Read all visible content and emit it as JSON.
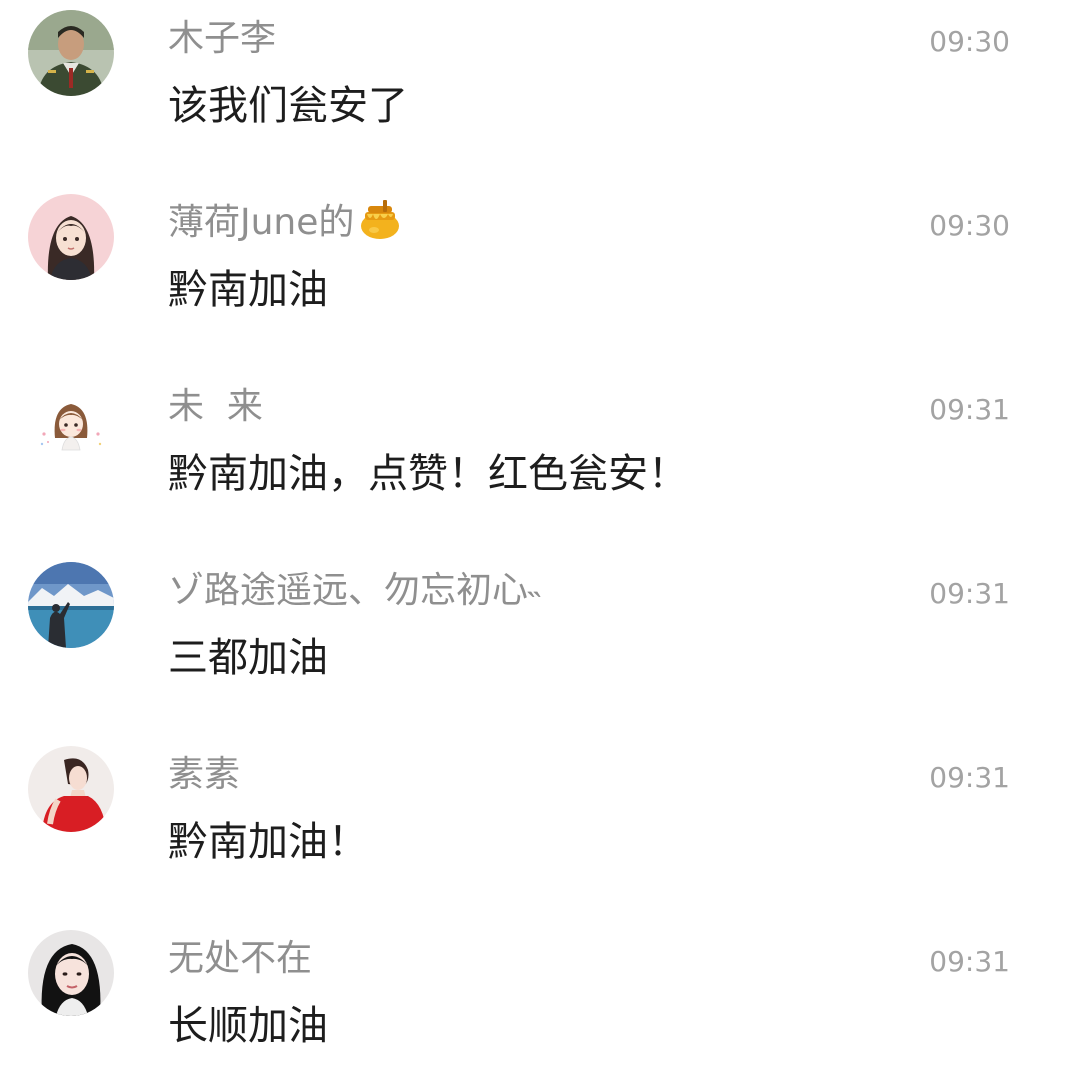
{
  "comments": [
    {
      "name": "木子李",
      "time": "09:30",
      "text": "该我们瓮安了",
      "avatar_icon": "soldier-portrait-icon"
    },
    {
      "name": "薄荷June的",
      "name_emoji": "honey-pot-icon",
      "time": "09:30",
      "text": "黔南加油",
      "avatar_icon": "cartoon-girl-icon"
    },
    {
      "name": "未  来",
      "time": "09:31",
      "text": "黔南加油，点赞！红色瓮安！",
      "avatar_icon": "chibi-girl-icon"
    },
    {
      "name": "ゾ路途遥远、勿忘初心˵",
      "time": "09:31",
      "text": "三都加油",
      "avatar_icon": "lake-landscape-icon"
    },
    {
      "name": "素素",
      "time": "09:31",
      "text": "黔南加油！",
      "avatar_icon": "woman-red-dress-icon"
    },
    {
      "name": "无处不在",
      "time": "09:31",
      "text": "长顺加油",
      "avatar_icon": "woman-portrait-icon"
    }
  ],
  "colors": {
    "name": "#8f8f8f",
    "time": "#a3a3a3",
    "text": "#1d1d1d",
    "background": "#ffffff"
  }
}
